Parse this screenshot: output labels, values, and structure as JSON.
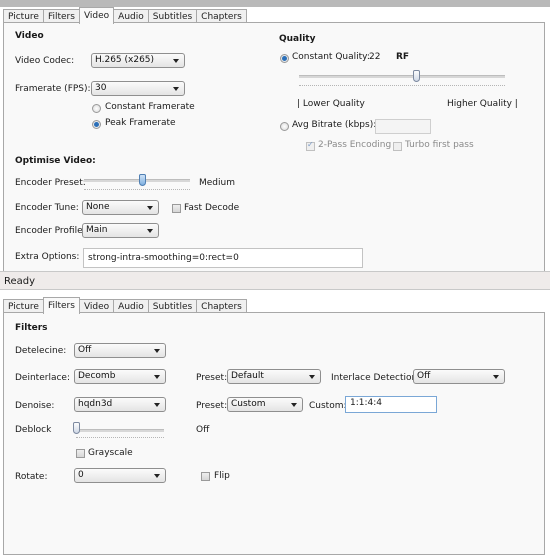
{
  "video_window": {
    "tabs": [
      "Picture",
      "Filters",
      "Video",
      "Audio",
      "Subtitles",
      "Chapters"
    ],
    "active_tab": "Video",
    "video_section": {
      "heading": "Video",
      "codec_label": "Video Codec:",
      "codec_value": "H.265 (x265)",
      "framerate_label": "Framerate (FPS):",
      "framerate_value": "30",
      "constant_framerate_label": "Constant Framerate",
      "peak_framerate_label": "Peak Framerate",
      "selected_framerate_mode": "Peak Framerate"
    },
    "quality_section": {
      "heading": "Quality",
      "constant_quality_label": "Constant Quality:",
      "constant_quality_value": "22",
      "rf_label": "RF",
      "quality_slider_fraction": 0.57,
      "lower_quality_label": "| Lower Quality",
      "higher_quality_label": "Higher Quality |",
      "avg_bitrate_label": "Avg Bitrate (kbps):",
      "avg_bitrate_value": "",
      "two_pass_label": "2-Pass Encoding",
      "two_pass_checked": true,
      "turbo_label": "Turbo first pass",
      "turbo_checked": false,
      "selected_mode": "Constant Quality"
    },
    "optimise_section": {
      "heading": "Optimise Video:",
      "preset_label": "Encoder Preset:",
      "preset_value": "Medium",
      "preset_slider_fraction": 0.55,
      "tune_label": "Encoder Tune:",
      "tune_value": "None",
      "fast_decode_label": "Fast Decode",
      "fast_decode_checked": false,
      "profile_label": "Encoder Profile:",
      "profile_value": "Main",
      "extra_options_label": "Extra Options:",
      "extra_options_value": "strong-intra-smoothing=0:rect=0"
    }
  },
  "status_bar": {
    "text": "Ready"
  },
  "filters_window": {
    "tabs": [
      "Picture",
      "Filters",
      "Video",
      "Audio",
      "Subtitles",
      "Chapters"
    ],
    "active_tab": "Filters",
    "heading": "Filters",
    "detelecine_label": "Detelecine:",
    "detelecine_value": "Off",
    "deinterlace_label": "Deinterlace:",
    "deinterlace_value": "Decomb",
    "deinterlace_preset_label": "Preset:",
    "deinterlace_preset_value": "Default",
    "interlace_detection_label": "Interlace Detection:",
    "interlace_detection_value": "Off",
    "denoise_label": "Denoise:",
    "denoise_value": "hqdn3d",
    "denoise_preset_label": "Preset:",
    "denoise_preset_value": "Custom",
    "custom_label": "Custom:",
    "custom_value": "1:1:4:4",
    "deblock_label": "Deblock",
    "deblock_value": "Off",
    "deblock_slider_fraction": 0,
    "grayscale_label": "Grayscale",
    "grayscale_checked": false,
    "rotate_label": "Rotate:",
    "rotate_value": "0",
    "flip_label": "Flip",
    "flip_checked": false
  }
}
